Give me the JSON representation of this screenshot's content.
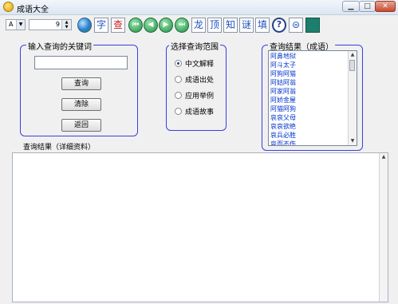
{
  "window": {
    "title": "成语大全"
  },
  "toolbar": {
    "font_combo_value": "A",
    "spin_value": "9",
    "buttons": [
      {
        "name": "globe-icon",
        "glyph": ""
      },
      {
        "name": "zi-button",
        "glyph": "字"
      },
      {
        "name": "cha-button",
        "glyph": "查"
      },
      {
        "name": "first-icon",
        "glyph": "⏮"
      },
      {
        "name": "prev-icon",
        "glyph": "◀"
      },
      {
        "name": "next-icon",
        "glyph": "▶"
      },
      {
        "name": "last-icon",
        "glyph": "⏭"
      },
      {
        "name": "long-button",
        "glyph": "龙"
      },
      {
        "name": "ding-button",
        "glyph": "顶"
      },
      {
        "name": "zhi-button",
        "glyph": "知"
      },
      {
        "name": "mi-button",
        "glyph": "谜"
      },
      {
        "name": "tian-button",
        "glyph": "填"
      },
      {
        "name": "help-icon",
        "glyph": "?"
      },
      {
        "name": "print-icon",
        "glyph": "⊜"
      },
      {
        "name": "library-icon",
        "glyph": ""
      }
    ]
  },
  "keyword_group": {
    "label": "输入查询的关键词",
    "input_value": "",
    "query_button": "查询",
    "clear_button": "清除",
    "back_button": "返回"
  },
  "scope_group": {
    "label": "选择查询范围",
    "options": [
      {
        "label": "中文解释",
        "checked": true
      },
      {
        "label": "成语出处",
        "checked": false
      },
      {
        "label": "应用举例",
        "checked": false
      },
      {
        "label": "成语故事",
        "checked": false
      }
    ]
  },
  "results_group": {
    "label": "查询结果（成语）",
    "items": [
      "阿鼻地狱",
      "阿斗太子",
      "阿狗阿猫",
      "阿姑阿翁",
      "阿家阿翁",
      "阿娇金屋",
      "阿猫阿狗",
      "哀哀父母",
      "哀哀欲绝",
      "哀兵必胜",
      "哀而不伤"
    ]
  },
  "detail": {
    "label": "查询结果（详细资料）",
    "content": ""
  }
}
